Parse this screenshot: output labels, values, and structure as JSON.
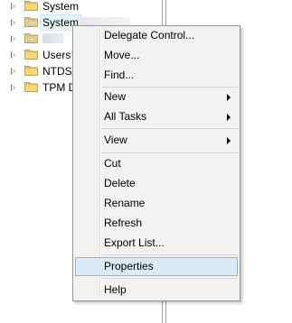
{
  "tree": {
    "items": [
      {
        "label": "System"
      },
      {
        "label": "System"
      },
      {
        "label": ""
      },
      {
        "label": "Users"
      },
      {
        "label": "NTDS"
      },
      {
        "label": "TPM D"
      }
    ]
  },
  "context_menu": {
    "items": [
      {
        "label": "Delegate Control..."
      },
      {
        "label": "Move..."
      },
      {
        "label": "Find..."
      },
      {
        "label": "New",
        "has_submenu": true
      },
      {
        "label": "All Tasks",
        "has_submenu": true
      },
      {
        "label": "View",
        "has_submenu": true
      },
      {
        "label": "Cut"
      },
      {
        "label": "Delete"
      },
      {
        "label": "Rename"
      },
      {
        "label": "Refresh"
      },
      {
        "label": "Export List..."
      },
      {
        "label": "Properties",
        "highlighted": true
      },
      {
        "label": "Help"
      }
    ]
  },
  "colors": {
    "menu_background": "#f2f2f2",
    "menu_highlight": "#dbeaf7",
    "menu_highlight_border": "#8fb8dc",
    "folder_yellow": "#e8c05a"
  },
  "icons": {
    "tree_expander": "chevron-right-icon",
    "tree_item": "folder-icon",
    "submenu": "submenu-arrow-icon"
  }
}
